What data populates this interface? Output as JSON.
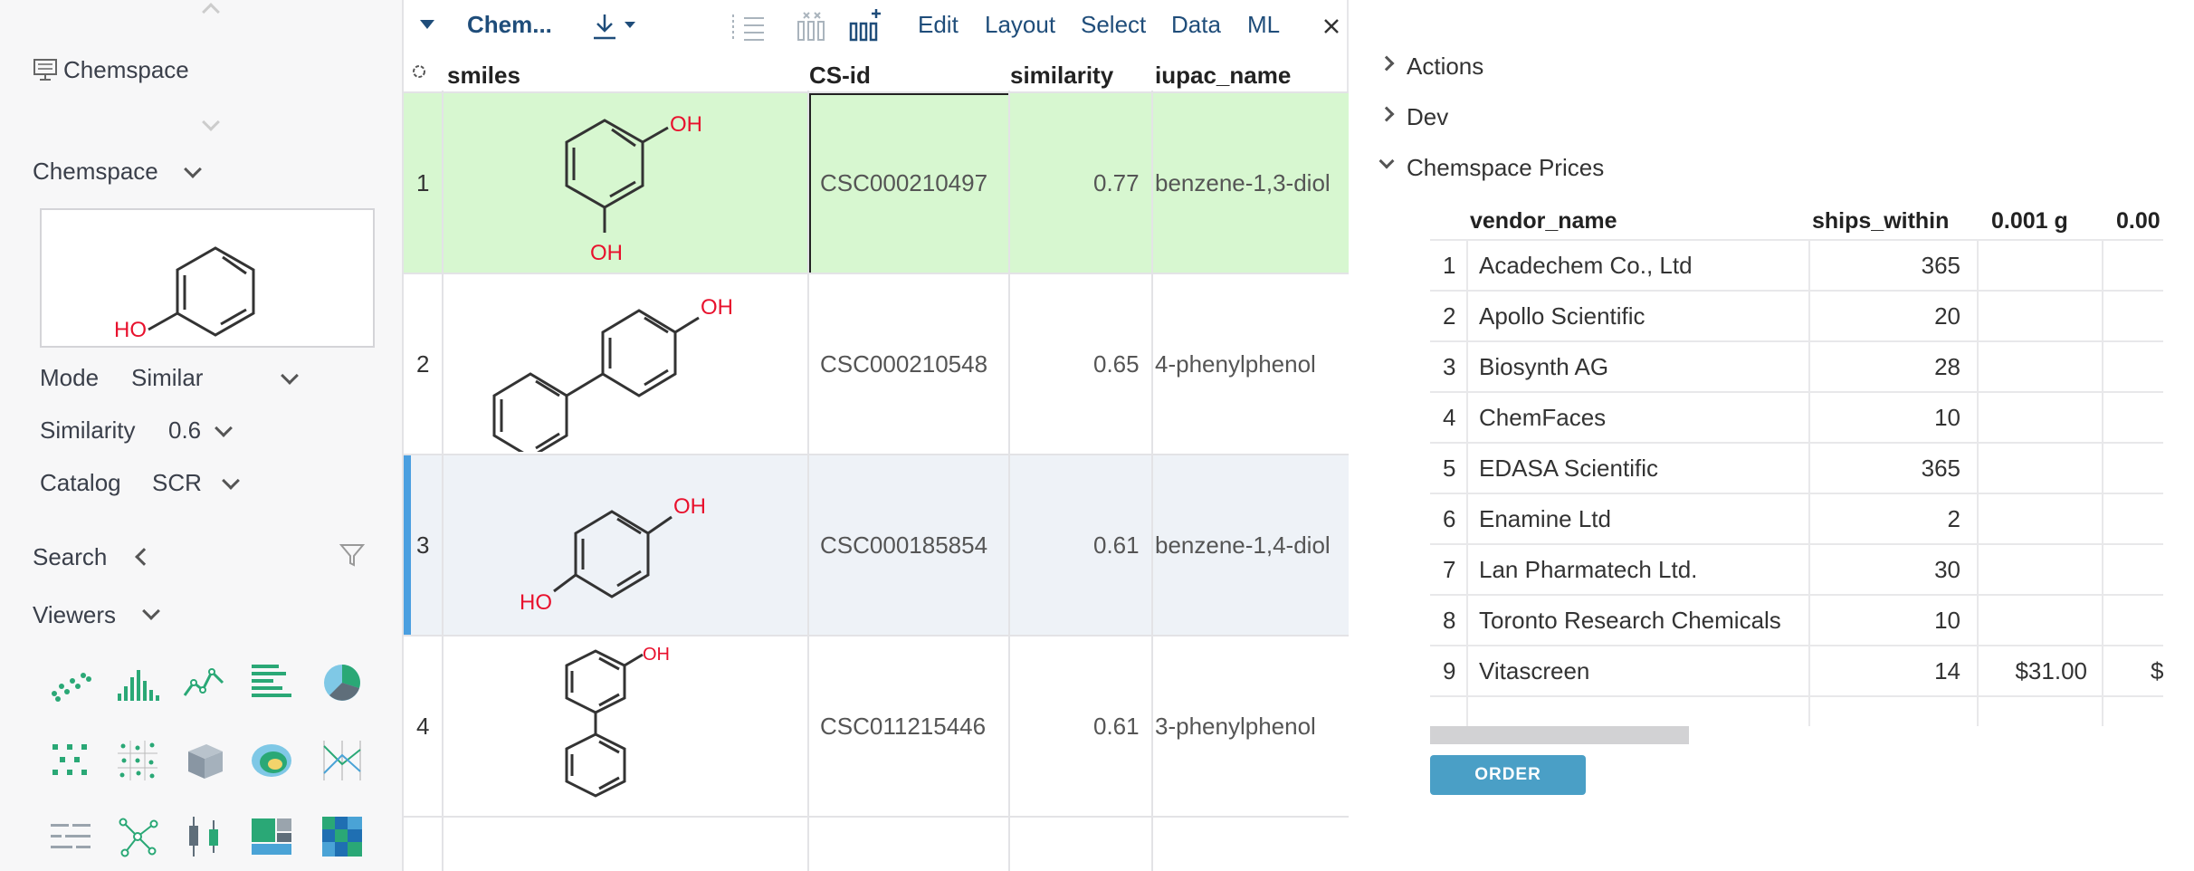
{
  "left_panel": {
    "project_name": "Chemspace",
    "app_name": "Chemspace",
    "query_molecule": {
      "label_oh": "HO"
    },
    "params": [
      {
        "label": "Mode",
        "value": "Similar"
      },
      {
        "label": "Similarity",
        "value": "0.6"
      },
      {
        "label": "Catalog",
        "value": "SCR"
      }
    ],
    "search_label": "Search",
    "viewers_label": "Viewers",
    "viewer_icons": [
      "scatter-plot-icon",
      "histogram-icon",
      "line-chart-icon",
      "bar-chart-icon",
      "pie-chart-icon",
      "matrix-plot-icon",
      "scatter-matrix-icon",
      "3d-scatter-icon",
      "density-plot-icon",
      "pc-plot-icon",
      "statistics-icon",
      "network-icon",
      "box-plot-icon",
      "tree-map-icon",
      "heat-map-icon"
    ]
  },
  "grid": {
    "title": "Chem...",
    "menu": [
      "Edit",
      "Layout",
      "Select",
      "Data",
      "ML"
    ],
    "columns": [
      "smiles",
      "CS-id",
      "similarity",
      "iupac_name"
    ],
    "rows": [
      {
        "num": "1",
        "cs_id": "CSC000210497",
        "similarity": "0.77",
        "iupac": "benzene-1,3-diol",
        "labels": [
          "OH",
          "OH"
        ]
      },
      {
        "num": "2",
        "cs_id": "CSC000210548",
        "similarity": "0.65",
        "iupac": "4-phenylphenol",
        "labels": [
          "OH"
        ]
      },
      {
        "num": "3",
        "cs_id": "CSC000185854",
        "similarity": "0.61",
        "iupac": "benzene-1,4-diol",
        "labels": [
          "OH",
          "HO"
        ]
      },
      {
        "num": "4",
        "cs_id": "CSC011215446",
        "similarity": "0.61",
        "iupac": "3-phenylphenol",
        "labels": [
          "OH"
        ]
      }
    ],
    "colors": {
      "selected_row": "#d7f7d0",
      "current_row": "#eef2f7",
      "current_marker": "#4a9fe0"
    }
  },
  "right_panel": {
    "sections": [
      {
        "label": "Actions",
        "expanded": false
      },
      {
        "label": "Dev",
        "expanded": false
      },
      {
        "label": "Chemspace Prices",
        "expanded": true
      }
    ],
    "price_table": {
      "columns": [
        "vendor_name",
        "ships_within",
        "0.001 g",
        "0.00"
      ],
      "rows": [
        {
          "num": "1",
          "vendor": "Acadechem Co., Ltd",
          "ships": "365",
          "price": ""
        },
        {
          "num": "2",
          "vendor": "Apollo Scientific",
          "ships": "20",
          "price": ""
        },
        {
          "num": "3",
          "vendor": "Biosynth AG",
          "ships": "28",
          "price": ""
        },
        {
          "num": "4",
          "vendor": "ChemFaces",
          "ships": "10",
          "price": ""
        },
        {
          "num": "5",
          "vendor": "EDASA Scientific",
          "ships": "365",
          "price": ""
        },
        {
          "num": "6",
          "vendor": "Enamine Ltd",
          "ships": "2",
          "price": ""
        },
        {
          "num": "7",
          "vendor": "Lan Pharmatech Ltd.",
          "ships": "30",
          "price": ""
        },
        {
          "num": "8",
          "vendor": "Toronto Research Chemicals",
          "ships": "10",
          "price": ""
        },
        {
          "num": "9",
          "vendor": "Vitascreen",
          "ships": "14",
          "price": "$31.00",
          "price2": "$"
        }
      ]
    },
    "order_button": "ORDER"
  }
}
